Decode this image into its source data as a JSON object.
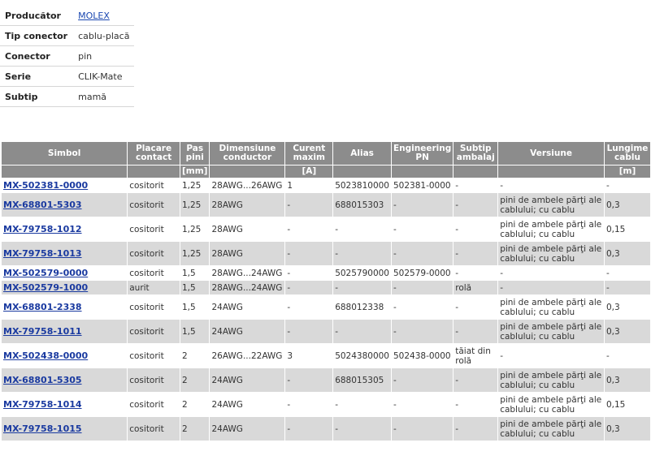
{
  "info": [
    {
      "label": "Producător",
      "value": "MOLEX",
      "link": true
    },
    {
      "label": "Tip conector",
      "value": "cablu-placă"
    },
    {
      "label": "Conector",
      "value": "pin"
    },
    {
      "label": "Serie",
      "value": "CLIK-Mate"
    },
    {
      "label": "Subtip",
      "value": "mamă"
    }
  ],
  "table": {
    "headers": [
      "Simbol",
      "Placare contact",
      "Pas pini",
      "Dimensiune conductor",
      "Curent maxim",
      "Alias",
      "Engineering PN",
      "Subtip ambalaj",
      "Versiune",
      "Lungime cablu"
    ],
    "units": [
      "",
      "",
      "[mm]",
      "",
      "[A]",
      "",
      "",
      "",
      "",
      "[m]"
    ],
    "rows": [
      [
        "MX-502381-0000",
        "cositorit",
        "1,25",
        "28AWG...26AWG",
        "1",
        "5023810000",
        "502381-0000",
        "-",
        "-",
        "-"
      ],
      [
        "MX-68801-5303",
        "cositorit",
        "1,25",
        "28AWG",
        "-",
        "688015303",
        "-",
        "-",
        "pini de ambele părţi ale cablului; cu cablu",
        "0,3"
      ],
      [
        "MX-79758-1012",
        "cositorit",
        "1,25",
        "28AWG",
        "-",
        "-",
        "-",
        "-",
        "pini de ambele părţi ale cablului; cu cablu",
        "0,15"
      ],
      [
        "MX-79758-1013",
        "cositorit",
        "1,25",
        "28AWG",
        "-",
        "-",
        "-",
        "-",
        "pini de ambele părţi ale cablului; cu cablu",
        "0,3"
      ],
      [
        "MX-502579-0000",
        "cositorit",
        "1,5",
        "28AWG...24AWG",
        "-",
        "5025790000",
        "502579-0000",
        "-",
        "-",
        "-"
      ],
      [
        "MX-502579-1000",
        "aurit",
        "1,5",
        "28AWG...24AWG",
        "-",
        "-",
        "-",
        "rolă",
        "-",
        "-"
      ],
      [
        "MX-68801-2338",
        "cositorit",
        "1,5",
        "24AWG",
        "-",
        "688012338",
        "-",
        "-",
        "pini de ambele părţi ale cablului; cu cablu",
        "0,3"
      ],
      [
        "MX-79758-1011",
        "cositorit",
        "1,5",
        "24AWG",
        "-",
        "-",
        "-",
        "-",
        "pini de ambele părţi ale cablului; cu cablu",
        "0,3"
      ],
      [
        "MX-502438-0000",
        "cositorit",
        "2",
        "26AWG...22AWG",
        "3",
        "5024380000",
        "502438-0000",
        "tăiat din rolă",
        "-",
        "-"
      ],
      [
        "MX-68801-5305",
        "cositorit",
        "2",
        "24AWG",
        "-",
        "688015305",
        "-",
        "-",
        "pini de ambele părţi ale cablului; cu cablu",
        "0,3"
      ],
      [
        "MX-79758-1014",
        "cositorit",
        "2",
        "24AWG",
        "-",
        "-",
        "-",
        "-",
        "pini de ambele părţi ale cablului; cu cablu",
        "0,15"
      ],
      [
        "MX-79758-1015",
        "cositorit",
        "2",
        "24AWG",
        "-",
        "-",
        "-",
        "-",
        "pini de ambele părţi ale cablului; cu cablu",
        "0,3"
      ]
    ]
  }
}
